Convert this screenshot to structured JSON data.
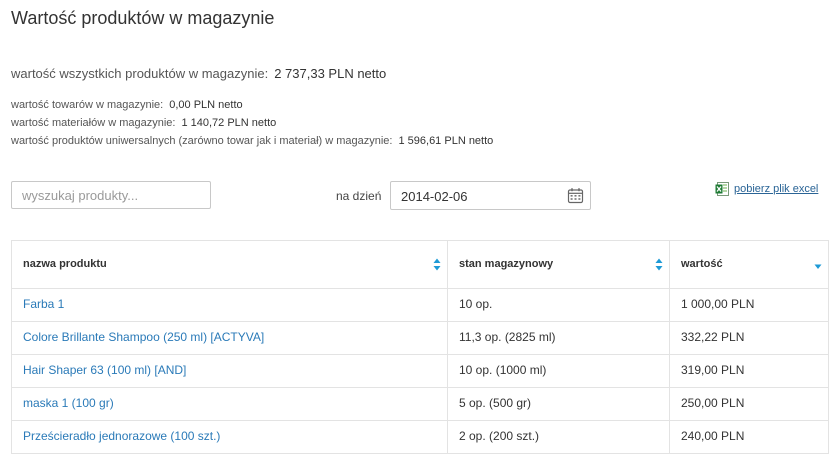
{
  "page": {
    "title": "Wartość produktów w magazynie"
  },
  "summary": {
    "total_label": "wartość wszystkich produktów w magazynie:",
    "total_value": "2 737,33 PLN netto",
    "goods_label": "wartość towarów w magazynie:",
    "goods_value": "0,00 PLN netto",
    "materials_label": "wartość materiałów w magazynie:",
    "materials_value": "1 140,72 PLN netto",
    "universal_label": "wartość produktów uniwersalnych (zarówno towar jak i materiał) w magazynie:",
    "universal_value": "1 596,61 PLN netto"
  },
  "filters": {
    "search_placeholder": "wyszukaj produkty...",
    "search_value": "",
    "date_label": "na dzień",
    "date_value": "2014-02-06",
    "excel_link": "pobierz plik excel"
  },
  "table": {
    "columns": [
      "nazwa produktu",
      "stan magazynowy",
      "wartość"
    ],
    "rows": [
      [
        "Farba 1",
        "10 op.",
        "1 000,00 PLN"
      ],
      [
        "Colore Brillante Shampoo (250 ml) [ACTYVA]",
        "11,3 op. (2825 ml)",
        "332,22 PLN"
      ],
      [
        "Hair Shaper 63 (100 ml) [AND]",
        "10 op. (1000 ml)",
        "319,00 PLN"
      ],
      [
        "maska 1 (100 gr)",
        "5 op. (500 gr)",
        "250,00 PLN"
      ],
      [
        "Prześcieradło jednorazowe (100 szt.)",
        "2 op. (200 szt.)",
        "240,00 PLN"
      ]
    ]
  },
  "colors": {
    "link": "#2a7ab8",
    "sort_arrow": "#1e9ad6",
    "border": "#e3e3e3"
  },
  "icons": {
    "calendar": "calendar-icon",
    "excel": "excel-file-icon",
    "sort": "sort-arrows-icon",
    "sort_desc": "sort-desc-icon"
  }
}
